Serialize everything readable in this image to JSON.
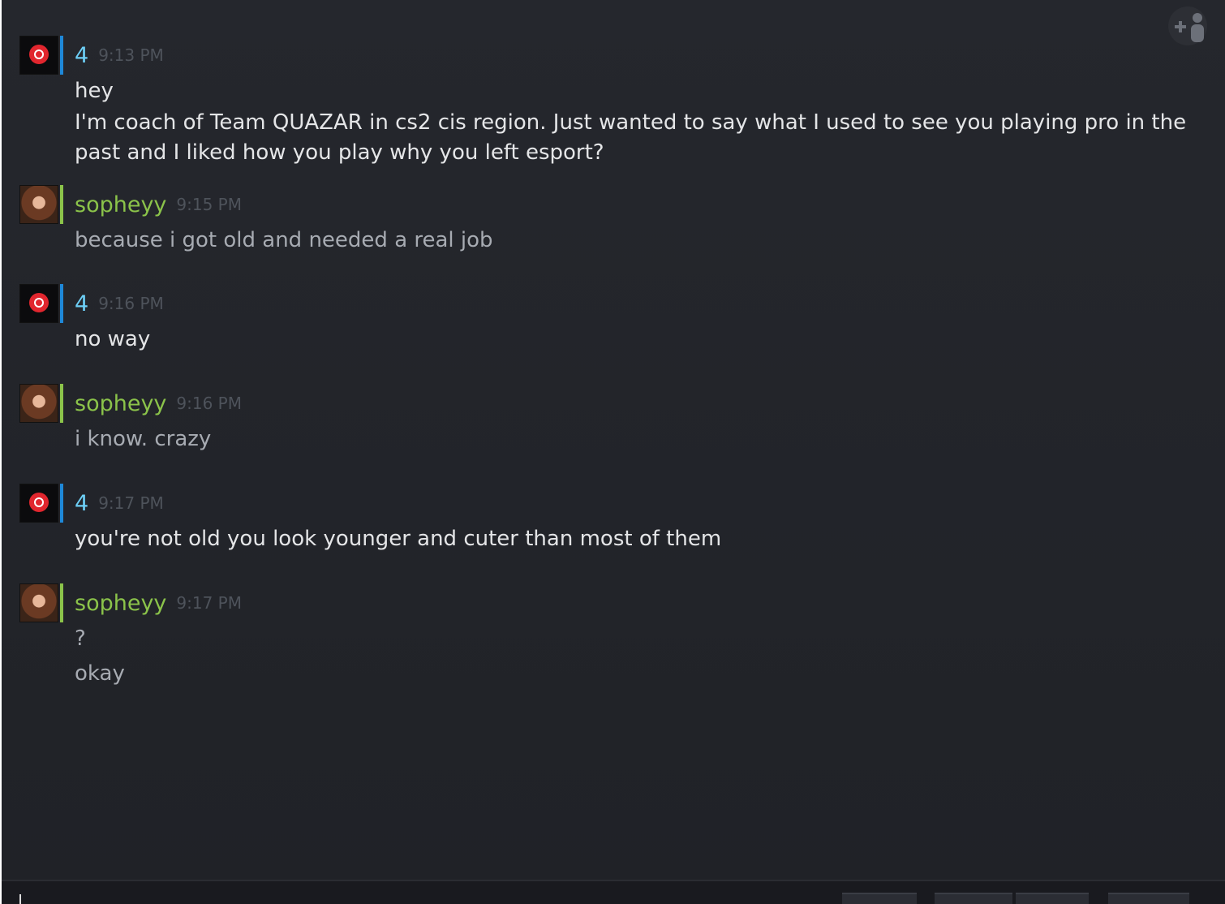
{
  "chat": {
    "groups": [
      {
        "sender": "4",
        "time": "9:13 PM",
        "role": "friend",
        "messages": [
          "hey",
          "I'm coach of Team QUAZAR in cs2 cis region. Just wanted to say what I used to see you playing pro in the past and I liked how you play why you left esport?"
        ]
      },
      {
        "sender": "sopheyy",
        "time": "9:15 PM",
        "role": "me",
        "messages": [
          "because i got old and needed a real job"
        ]
      },
      {
        "sender": "4",
        "time": "9:16 PM",
        "role": "friend",
        "messages": [
          "no way"
        ]
      },
      {
        "sender": "sopheyy",
        "time": "9:16 PM",
        "role": "me",
        "messages": [
          "i know. crazy"
        ]
      },
      {
        "sender": "4",
        "time": "9:17 PM",
        "role": "friend",
        "messages": [
          "you're not old you look younger and cuter than most of them"
        ]
      },
      {
        "sender": "sopheyy",
        "time": "9:17 PM",
        "role": "me",
        "messages": [
          "?",
          "okay"
        ]
      }
    ]
  },
  "icons": {
    "add_friend": "add-friend-icon"
  },
  "colors": {
    "background": "#23252a",
    "friend_name": "#6dcff6",
    "self_name": "#8bc34a",
    "friend_status_bar": "#1e88d8",
    "self_status_bar": "#8bc34a",
    "timestamp": "#4e535b"
  }
}
